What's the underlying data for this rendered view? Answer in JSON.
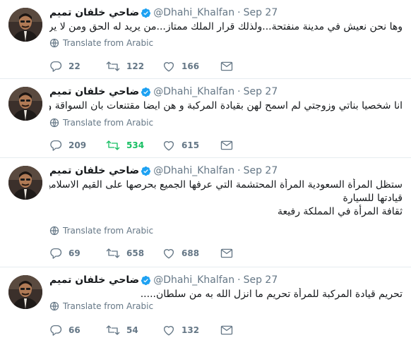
{
  "tweets": [
    {
      "name": "ضاحي خلفان تميم",
      "handle": "@Dhahi_Khalfan",
      "separator": "·",
      "date": "Sep 27",
      "lines": [
        "وها نحن نعيش في مدينة منفتحة...ولذلك قرار الملك ممتاز...من يريد له الحق ومن لا يريد فهو حر"
      ],
      "translate": "Translate from Arabic",
      "replies": "22",
      "retweets": "122",
      "likes": "166",
      "retweeted": false
    },
    {
      "name": "ضاحي خلفان تميم",
      "handle": "@Dhahi_Khalfan",
      "separator": "·",
      "date": "Sep 27",
      "lines": [
        "انا شخصيا بناتي وزوجتي لم اسمح لهن بقيادة المركبة و هن ايضا مقتنعات بان السواقة وجعة رأس...."
      ],
      "translate": "Translate from Arabic",
      "replies": "209",
      "retweets": "534",
      "likes": "615",
      "retweeted": true
    },
    {
      "name": "ضاحي خلفان تميم",
      "handle": "@Dhahi_Khalfan",
      "separator": "·",
      "date": "Sep 27",
      "lines": [
        "ستظل المرأة السعودية المرأة المحتشمة التي عرفها الجميع بحرصها على القيم الاسلامية والعربية رغم",
        "قيادتها للسيارة",
        "ثقافة المرأة في المملكة رفيعة"
      ],
      "translate": "Translate from Arabic",
      "replies": "69",
      "retweets": "658",
      "likes": "688",
      "retweeted": false
    },
    {
      "name": "ضاحي خلفان تميم",
      "handle": "@Dhahi_Khalfan",
      "separator": "·",
      "date": "Sep 27",
      "lines": [
        "تحريم قيادة المركبة للمرأة تحريم ما انزل الله به من سلطان....."
      ],
      "translate": "Translate from Arabic",
      "replies": "66",
      "retweets": "54",
      "likes": "132",
      "retweeted": false
    }
  ],
  "icons": {
    "verified": "verified-badge-icon",
    "translate": "globe-icon",
    "reply": "reply-icon",
    "retweet": "retweet-icon",
    "like": "heart-icon",
    "message": "envelope-icon"
  },
  "colors": {
    "text": "#14171a",
    "secondary": "#657786",
    "verified": "#1da1f2",
    "retweeted": "#17bf63",
    "divider": "#e6ecf0"
  }
}
